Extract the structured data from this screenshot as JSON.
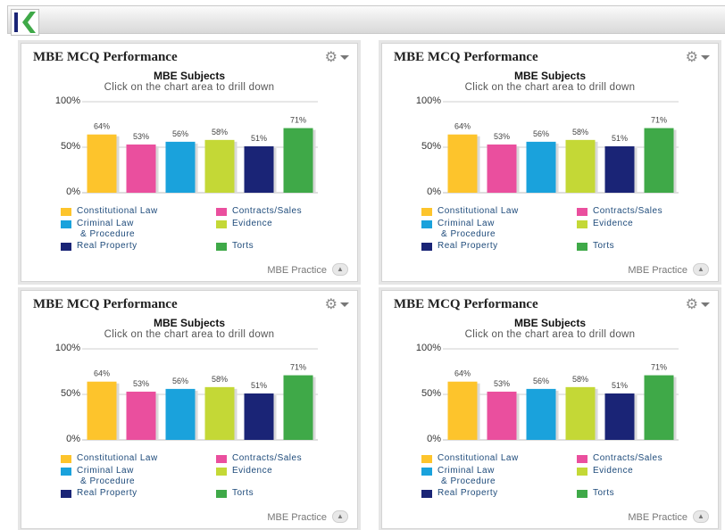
{
  "colors": {
    "gridline": "#cfcfcf",
    "axis": "#bdbdbd",
    "bar_shadow": "#d9d9d9",
    "label": "#444444"
  },
  "panels": [
    {
      "title": "MBE MCQ Performance",
      "gear_icon": "⚙",
      "footer_text": "MBE Practice",
      "chart_data": {
        "type": "bar",
        "title": "MBE Subjects",
        "subtitle": "Click on the chart area to drill down",
        "ylim": [
          0,
          100
        ],
        "yticks": [
          "0%",
          "50%",
          "100%"
        ],
        "categories": [
          "Constitutional Law",
          "Contracts/Sales",
          "Criminal Law & Procedure",
          "Evidence",
          "Real Property",
          "Torts"
        ],
        "values": [
          64,
          53,
          56,
          58,
          51,
          71
        ],
        "value_labels": [
          "64%",
          "53%",
          "56%",
          "58%",
          "51%",
          "71%"
        ],
        "colors": [
          "#fdc42c",
          "#ea4f9e",
          "#1aa2dc",
          "#c4d836",
          "#1a2476",
          "#3fa948"
        ],
        "legend": [
          {
            "line1": "Constitutional Law",
            "line2": ""
          },
          {
            "line1": "Contracts/Sales",
            "line2": ""
          },
          {
            "line1": "Criminal Law",
            "line2": "& Procedure"
          },
          {
            "line1": "Evidence",
            "line2": ""
          },
          {
            "line1": "Real Property",
            "line2": ""
          },
          {
            "line1": "Torts",
            "line2": ""
          }
        ]
      }
    },
    {
      "title": "MBE MCQ Performance",
      "gear_icon": "⚙",
      "footer_text": "MBE Practice",
      "chart_data": {
        "type": "bar",
        "title": "MBE Subjects",
        "subtitle": "Click on the chart area to drill down",
        "ylim": [
          0,
          100
        ],
        "yticks": [
          "0%",
          "50%",
          "100%"
        ],
        "categories": [
          "Constitutional Law",
          "Contracts/Sales",
          "Criminal Law & Procedure",
          "Evidence",
          "Real Property",
          "Torts"
        ],
        "values": [
          64,
          53,
          56,
          58,
          51,
          71
        ],
        "value_labels": [
          "64%",
          "53%",
          "56%",
          "58%",
          "51%",
          "71%"
        ],
        "colors": [
          "#fdc42c",
          "#ea4f9e",
          "#1aa2dc",
          "#c4d836",
          "#1a2476",
          "#3fa948"
        ],
        "legend": [
          {
            "line1": "Constitutional Law",
            "line2": ""
          },
          {
            "line1": "Contracts/Sales",
            "line2": ""
          },
          {
            "line1": "Criminal Law",
            "line2": "& Procedure"
          },
          {
            "line1": "Evidence",
            "line2": ""
          },
          {
            "line1": "Real Property",
            "line2": ""
          },
          {
            "line1": "Torts",
            "line2": ""
          }
        ]
      }
    },
    {
      "title": "MBE MCQ Performance",
      "gear_icon": "⚙",
      "footer_text": "MBE Practice",
      "chart_data": {
        "type": "bar",
        "title": "MBE Subjects",
        "subtitle": "Click on the chart area to drill down",
        "ylim": [
          0,
          100
        ],
        "yticks": [
          "0%",
          "50%",
          "100%"
        ],
        "categories": [
          "Constitutional Law",
          "Contracts/Sales",
          "Criminal Law & Procedure",
          "Evidence",
          "Real Property",
          "Torts"
        ],
        "values": [
          64,
          53,
          56,
          58,
          51,
          71
        ],
        "value_labels": [
          "64%",
          "53%",
          "56%",
          "58%",
          "51%",
          "71%"
        ],
        "colors": [
          "#fdc42c",
          "#ea4f9e",
          "#1aa2dc",
          "#c4d836",
          "#1a2476",
          "#3fa948"
        ],
        "legend": [
          {
            "line1": "Constitutional Law",
            "line2": ""
          },
          {
            "line1": "Contracts/Sales",
            "line2": ""
          },
          {
            "line1": "Criminal Law",
            "line2": "& Procedure"
          },
          {
            "line1": "Evidence",
            "line2": ""
          },
          {
            "line1": "Real Property",
            "line2": ""
          },
          {
            "line1": "Torts",
            "line2": ""
          }
        ]
      }
    },
    {
      "title": "MBE MCQ Performance",
      "gear_icon": "⚙",
      "footer_text": "MBE Practice",
      "chart_data": {
        "type": "bar",
        "title": "MBE Subjects",
        "subtitle": "Click on the chart area to drill down",
        "ylim": [
          0,
          100
        ],
        "yticks": [
          "0%",
          "50%",
          "100%"
        ],
        "categories": [
          "Constitutional Law",
          "Contracts/Sales",
          "Criminal Law & Procedure",
          "Evidence",
          "Real Property",
          "Torts"
        ],
        "values": [
          64,
          53,
          56,
          58,
          51,
          71
        ],
        "value_labels": [
          "64%",
          "53%",
          "56%",
          "58%",
          "51%",
          "71%"
        ],
        "colors": [
          "#fdc42c",
          "#ea4f9e",
          "#1aa2dc",
          "#c4d836",
          "#1a2476",
          "#3fa948"
        ],
        "legend": [
          {
            "line1": "Constitutional Law",
            "line2": ""
          },
          {
            "line1": "Contracts/Sales",
            "line2": ""
          },
          {
            "line1": "Criminal Law",
            "line2": "& Procedure"
          },
          {
            "line1": "Evidence",
            "line2": ""
          },
          {
            "line1": "Real Property",
            "line2": ""
          },
          {
            "line1": "Torts",
            "line2": ""
          }
        ]
      }
    }
  ]
}
